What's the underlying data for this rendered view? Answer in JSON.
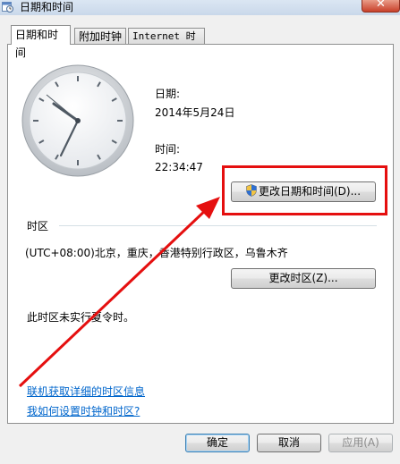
{
  "window": {
    "title": "日期和时间",
    "close_glyph": "✕"
  },
  "tabs": [
    {
      "label": "日期和时间",
      "active": true
    },
    {
      "label": "附加时钟",
      "active": false
    },
    {
      "label": "Internet 时间",
      "active": false
    }
  ],
  "datetime": {
    "date_label": "日期:",
    "date_value": "2014年5月24日",
    "time_label": "时间:",
    "time_value": "22:34:47",
    "change_button": "更改日期和时间(D)..."
  },
  "timezone": {
    "section_label": "时区",
    "value": "(UTC+08:00)北京，重庆，香港特别行政区，乌鲁木齐",
    "change_button": "更改时区(Z)...",
    "dst_note": "此时区未实行夏令时。"
  },
  "links": {
    "online_info": "联机获取详细的时区信息",
    "how_to_set": "我如何设置时钟和时区?"
  },
  "footer": {
    "ok": "确定",
    "cancel": "取消",
    "apply": "应用(A)"
  },
  "icons": {
    "app": "calendar-clock-icon",
    "uac": "uac-shield-icon",
    "close": "close-icon"
  },
  "colors": {
    "annotation_red": "#e50f0f",
    "link_blue": "#0066cc"
  }
}
